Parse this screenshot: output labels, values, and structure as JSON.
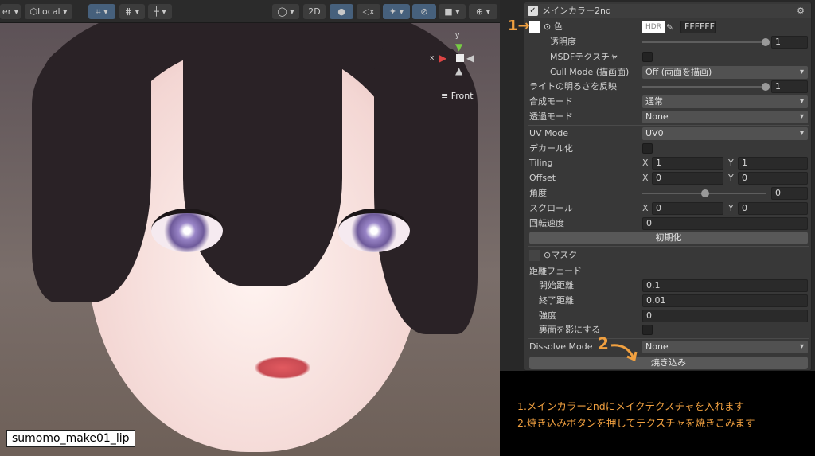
{
  "toolbar": {
    "pivot_partial": "er",
    "space": "Local",
    "mode_2d": "2D"
  },
  "viewport": {
    "gizmo_label": "Front",
    "gizmo_axes": {
      "x": "x",
      "y": "y"
    },
    "object_label": "sumomo_make01_lip"
  },
  "inspector": {
    "section_title": "メインカラー2nd",
    "color": {
      "label": "色",
      "hdr": "HDR",
      "hex": "FFFFFF"
    },
    "opacity": {
      "label": "透明度",
      "value": "1"
    },
    "msdf": {
      "label": "MSDFテクスチャ"
    },
    "cull": {
      "label": "Cull Mode (描画面)",
      "value": "Off (両面を描画)"
    },
    "light": {
      "label": "ライトの明るさを反映",
      "value": "1"
    },
    "blend": {
      "label": "合成モード",
      "value": "通常"
    },
    "alpha": {
      "label": "透過モード",
      "value": "None"
    },
    "uv": {
      "label": "UV Mode",
      "value": "UV0"
    },
    "decal": {
      "label": "デカール化"
    },
    "tiling": {
      "label": "Tiling",
      "x": "1",
      "y": "1"
    },
    "offset": {
      "label": "Offset",
      "x": "0",
      "y": "0"
    },
    "angle": {
      "label": "角度",
      "value": "0"
    },
    "scroll": {
      "label": "スクロール",
      "x": "0",
      "y": "0"
    },
    "rotation": {
      "label": "回転速度",
      "value": "0"
    },
    "reset": "初期化",
    "mask": {
      "label": "マスク"
    },
    "fade": {
      "label": "距離フェード",
      "start_label": "開始距離",
      "start": "0.1",
      "end_label": "終了距離",
      "end": "0.01",
      "strength_label": "強度",
      "strength": "0",
      "backface_label": "裏面を影にする"
    },
    "dissolve": {
      "label": "Dissolve Mode",
      "value": "None"
    },
    "bake": "焼き込み",
    "axis_x": "X",
    "axis_y": "Y"
  },
  "annotations": {
    "step1": "1",
    "step2": "2",
    "note1": "1.メインカラー2ndにメイクテクスチャを入れます",
    "note2": "2.焼き込みボタンを押してテクスチャを焼きこみます"
  },
  "colors": {
    "accent": "#f0a040",
    "panel": "#383838",
    "active_button": "#46607c"
  }
}
